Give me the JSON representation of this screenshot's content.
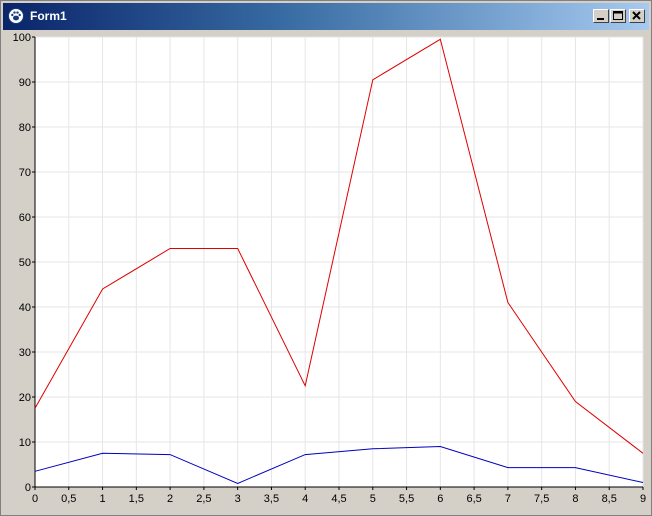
{
  "window": {
    "title": "Form1",
    "icon": "paw-icon"
  },
  "controls": {
    "minimize_icon": "minimize-icon",
    "maximize_icon": "maximize-icon",
    "close_icon": "close-icon"
  },
  "colors": {
    "series_red": "#e00000",
    "series_blue": "#0000c0",
    "grid": "#e6e6e6",
    "plot_background": "#ffffff"
  },
  "chart_data": {
    "type": "line",
    "title": "",
    "xlabel": "",
    "ylabel": "",
    "xlim": [
      0,
      9
    ],
    "ylim": [
      0,
      100
    ],
    "grid": true,
    "x_ticks": [
      "0",
      "0,5",
      "1",
      "1,5",
      "2",
      "2,5",
      "3",
      "3,5",
      "4",
      "4,5",
      "5",
      "5,5",
      "6",
      "6,5",
      "7",
      "7,5",
      "8",
      "8,5",
      "9"
    ],
    "y_ticks": [
      "0",
      "10",
      "20",
      "30",
      "40",
      "50",
      "60",
      "70",
      "80",
      "90",
      "100"
    ],
    "x": [
      0,
      1,
      2,
      3,
      4,
      5,
      6,
      7,
      8,
      9
    ],
    "series": [
      {
        "color": "#e00000",
        "values": [
          17.5,
          44,
          53,
          53,
          22.5,
          90.5,
          99.5,
          41,
          19,
          7.5
        ]
      },
      {
        "color": "#0000c0",
        "values": [
          3.5,
          7.5,
          7.2,
          0.8,
          7.2,
          8.5,
          9,
          4.3,
          4.3,
          1
        ]
      }
    ]
  }
}
